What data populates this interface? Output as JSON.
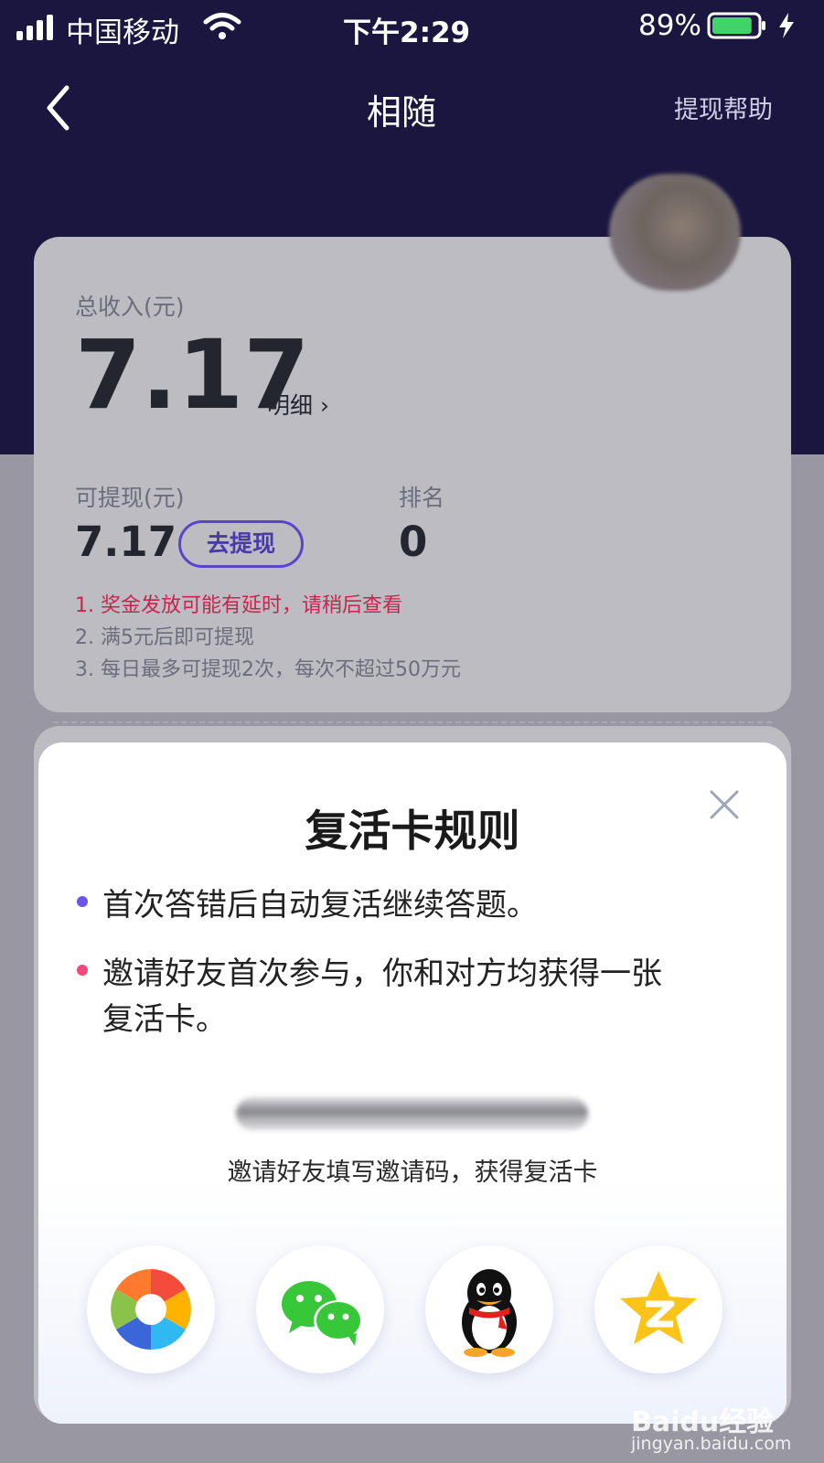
{
  "status": {
    "carrier": "中国移动",
    "time": "下午2:29",
    "battery": "89%",
    "battery_level": 0.89
  },
  "header": {
    "title": "相随",
    "help": "提现帮助"
  },
  "earnings": {
    "total_label": "总收入(元)",
    "total_value": "7.17",
    "detail_link": "明细 ›",
    "withdrawable_label": "可提现(元)",
    "withdrawable_value": "7.17",
    "withdraw_button": "去提现",
    "rank_label": "排名",
    "rank_value": "0",
    "notes": [
      "1. 奖金发放可能有延时，请稍后查看",
      "2. 满5元后即可提现",
      "3. 每日最多可提现2次，每次不超过50万元"
    ]
  },
  "modal": {
    "title": "复活卡规则",
    "rules": [
      {
        "text": "首次答错后自动复活继续答题。",
        "bullet_color": "#6d55e8"
      },
      {
        "text": "邀请好友首次参与，你和对方均获得一张复活卡。",
        "bullet_color": "#f0487d"
      }
    ],
    "invite_text": "邀请好友填写邀请码，获得复活卡",
    "share_targets": [
      "moments-icon",
      "wechat-icon",
      "qq-icon",
      "qzone-icon"
    ]
  },
  "watermark": {
    "brand": "Baidu经验",
    "url": "jingyan.baidu.com"
  },
  "colors": {
    "header_bg": "#1b1640",
    "accent": "#5a45c9",
    "warning_red": "#c7254e"
  }
}
